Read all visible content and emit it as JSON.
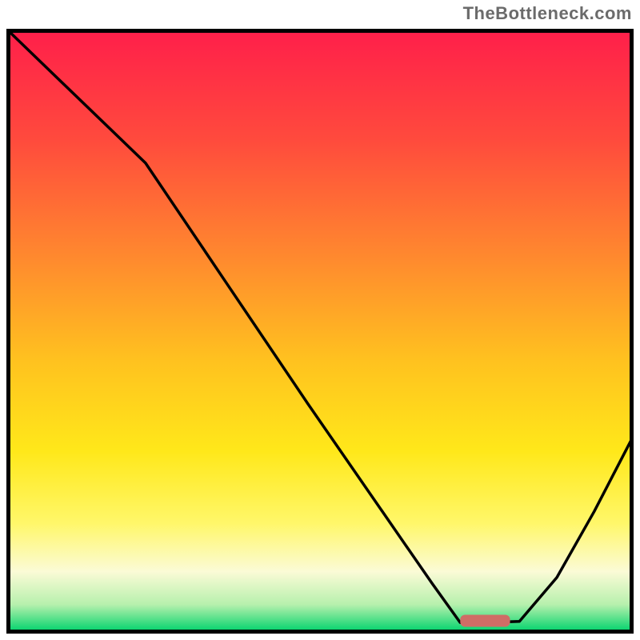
{
  "watermark": {
    "text": "TheBottleneck.com"
  },
  "chart_data": {
    "type": "line",
    "title": "",
    "xlabel": "",
    "ylabel": "",
    "xlim": [
      0,
      100
    ],
    "ylim": [
      0,
      100
    ],
    "grid": false,
    "legend": false,
    "gradient_bg": {
      "stops": [
        {
          "t": 0.0,
          "color": "#ff1f4a"
        },
        {
          "t": 0.18,
          "color": "#ff4a3d"
        },
        {
          "t": 0.38,
          "color": "#ff8a2e"
        },
        {
          "t": 0.55,
          "color": "#ffc21f"
        },
        {
          "t": 0.7,
          "color": "#ffe81a"
        },
        {
          "t": 0.82,
          "color": "#fff76a"
        },
        {
          "t": 0.9,
          "color": "#fbfbd6"
        },
        {
          "t": 0.955,
          "color": "#b7f0ad"
        },
        {
          "t": 1.0,
          "color": "#00d36c"
        }
      ]
    },
    "x": [
      0,
      8,
      22,
      35,
      48,
      60,
      68,
      72.5,
      77,
      82,
      88,
      94,
      100
    ],
    "values": [
      100,
      92,
      78,
      58,
      38,
      20,
      8,
      1.5,
      1.5,
      1.7,
      9,
      20,
      32
    ],
    "optimal_marker": {
      "x0": 72.5,
      "x1": 80.5,
      "y": 1.8,
      "height": 2.0
    }
  }
}
